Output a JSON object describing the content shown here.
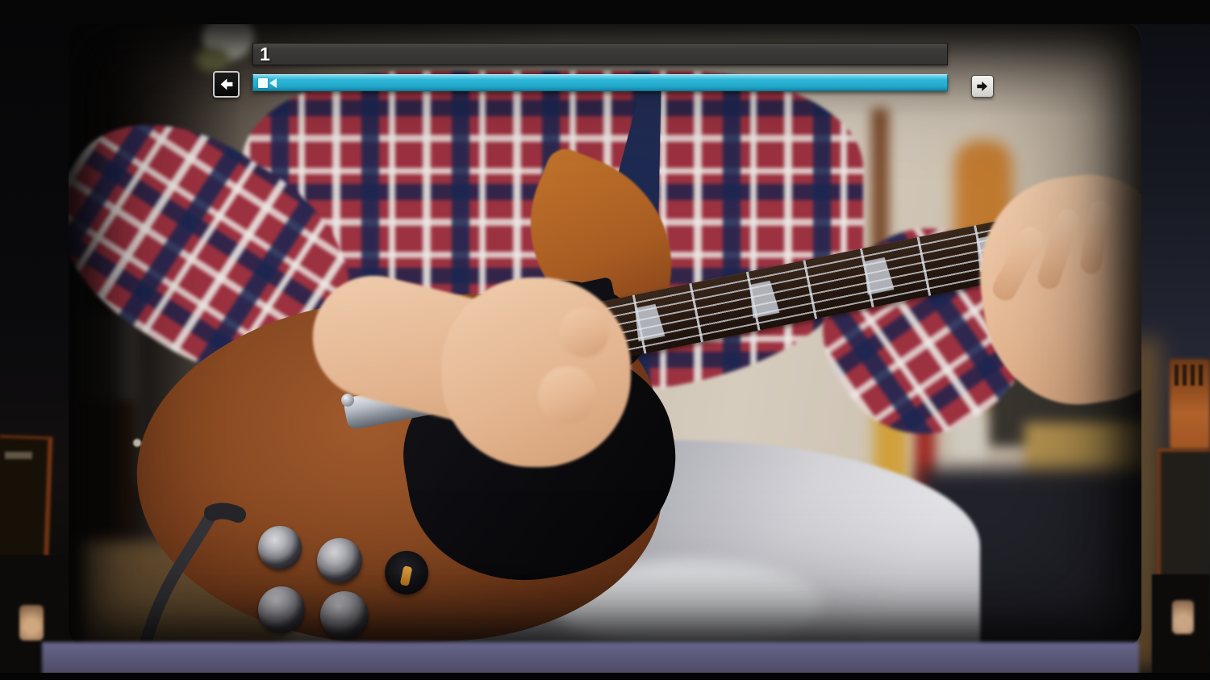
{
  "hud": {
    "section_bar": {
      "label": "1"
    },
    "timeline": {
      "icon": "video-camera-icon",
      "playhead_position_pct": 0
    },
    "prev_button": {
      "icon": "arrow-left-icon"
    },
    "next_button": {
      "icon": "arrow-right-icon"
    }
  },
  "colors": {
    "accent-cyan": "#2db6d8",
    "accent-cyan-light": "#7fdcee",
    "accent-cyan-dark": "#1187a8",
    "bar-dark": "#3b3a38",
    "bar-dark-edge": "#171717",
    "btn-dark": "#101010",
    "btn-border-light": "#cccccc",
    "btn-light": "#e8e6e2",
    "arrow-dark": "#141414",
    "floor-purple": "#5b5979"
  }
}
